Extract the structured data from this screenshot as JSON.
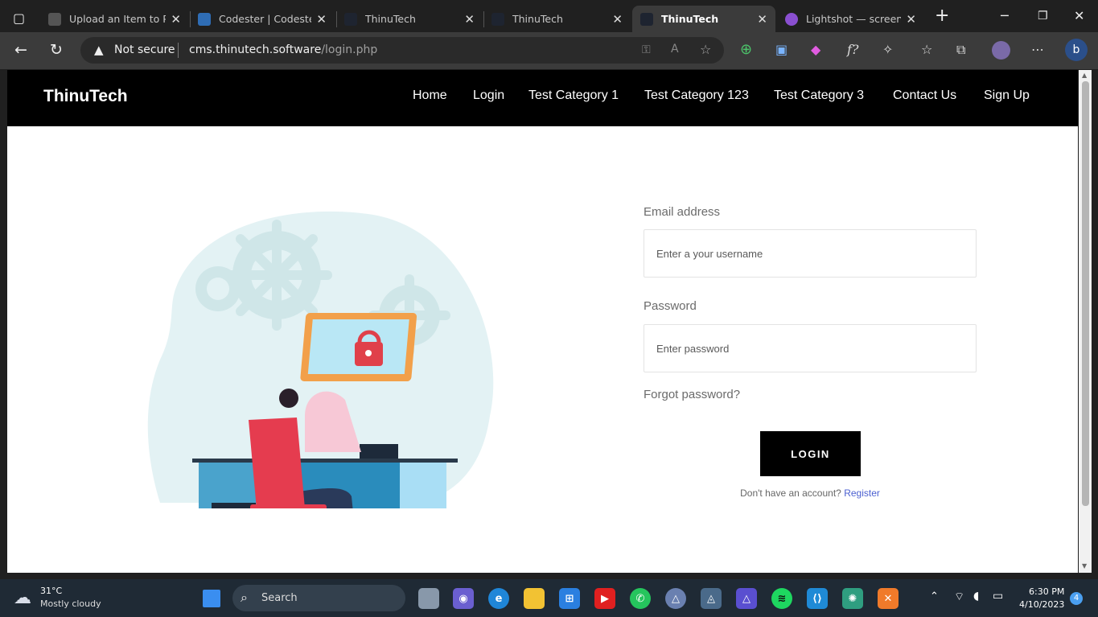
{
  "browser": {
    "tabs": [
      {
        "title": "Upload an Item to PH",
        "favicon_color": "#555555"
      },
      {
        "title": "Codester | Codester",
        "favicon_color": "#2f6db5"
      },
      {
        "title": "ThinuTech",
        "favicon_color": "#1e2430"
      },
      {
        "title": "ThinuTech",
        "favicon_color": "#1e2430"
      },
      {
        "title": "ThinuTech",
        "favicon_color": "#1e2430"
      },
      {
        "title": "Lightshot — screenshot",
        "favicon_color": "#8a4fd0"
      }
    ],
    "security_label": "Not secure",
    "url_host": "cms.thinutech.software",
    "url_path": "/login.php"
  },
  "site": {
    "brand": "ThinuTech",
    "nav": [
      "Home",
      "Login",
      "Test Category 1",
      "Test Category 123",
      "Test Category 3",
      "Contact Us",
      "Sign Up"
    ]
  },
  "login_form": {
    "email_label": "Email address",
    "email_placeholder": "Enter a your username",
    "password_label": "Password",
    "password_placeholder": "Enter password",
    "forgot": "Forgot password?",
    "button": "LOGIN",
    "register_prompt": "Don't have an account?",
    "register_link": "Register"
  },
  "taskbar": {
    "temperature": "31°C",
    "weather": "Mostly cloudy",
    "search": "Search",
    "time": "6:30 PM",
    "date": "4/10/2023",
    "notifications": "4"
  }
}
